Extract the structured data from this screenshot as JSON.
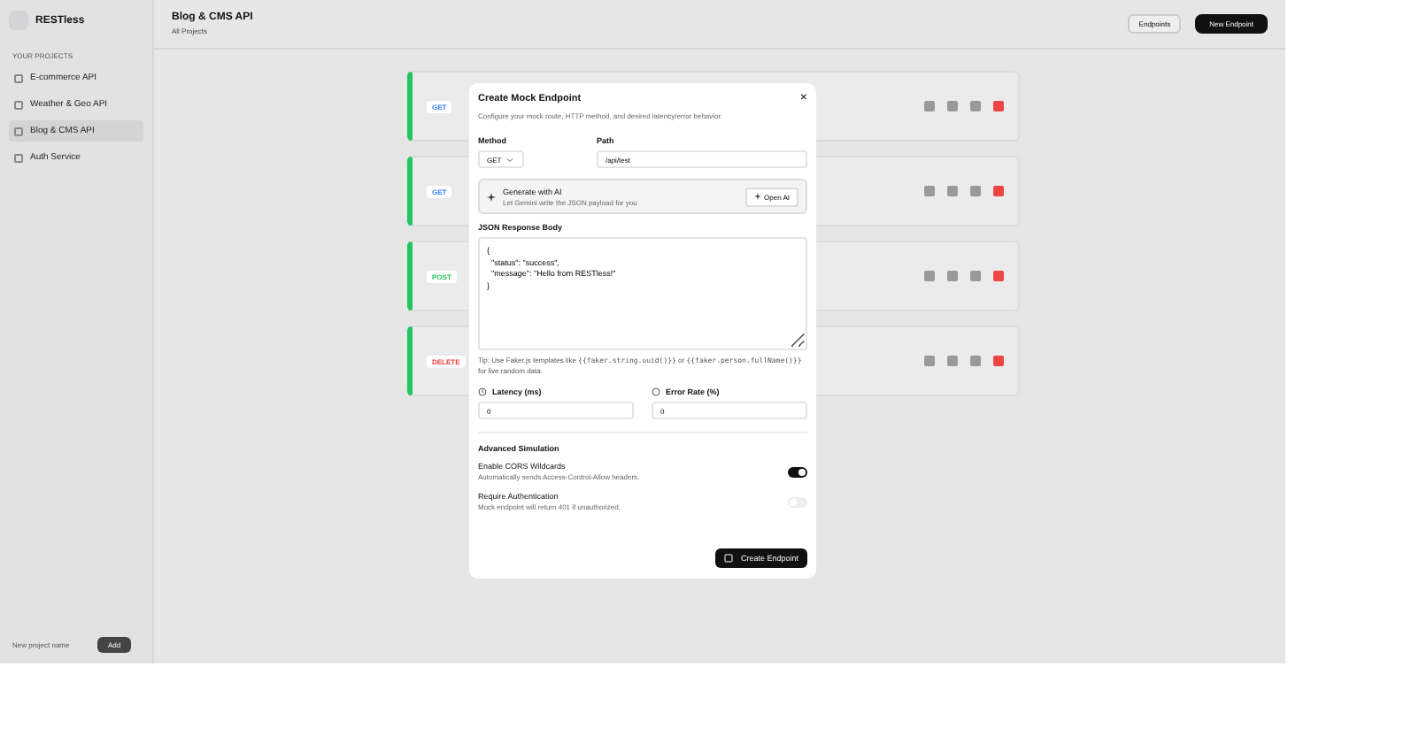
{
  "sidebar": {
    "brand": "RESTless",
    "section_label": "YOUR PROJECTS",
    "projects": [
      {
        "name": "E-commerce API",
        "selected": false
      },
      {
        "name": "Weather & Geo API",
        "selected": false
      },
      {
        "name": "Blog & CMS API",
        "selected": true
      },
      {
        "name": "Auth Service",
        "selected": false
      }
    ],
    "new_project": {
      "placeholder": "New project name",
      "button": "Add"
    }
  },
  "header": {
    "title": "Blog & CMS API",
    "breadcrumb": "All Projects",
    "view_select": "Endpoints",
    "primary_button": "New Endpoint"
  },
  "endpoints": [
    {
      "method": "GET",
      "color": "#3b82f6"
    },
    {
      "method": "GET",
      "color": "#3b82f6"
    },
    {
      "method": "POST",
      "color": "#22c55e"
    },
    {
      "method": "DELETE",
      "color": "#ef4444"
    }
  ],
  "dialog": {
    "title": "Create Mock Endpoint",
    "close": "×",
    "subtitle": "Configure your mock route, HTTP method, and desired latency/error behavior.",
    "method_label": "Method",
    "method_value": "GET",
    "path_label": "Path",
    "path_value": "/api/test",
    "ai": {
      "title": "Generate with AI",
      "subtitle": "Let Gemini write the JSON payload for you",
      "button": "Open AI"
    },
    "body_label": "JSON Response Body",
    "body_lines": [
      "{",
      "  \"status\": \"success\",",
      "  \"message\": \"Hello from RESTless!\"",
      "}"
    ],
    "tip": [
      {
        "kind": "plain",
        "text": "Tip: Use Faker.js templates like "
      },
      {
        "kind": "code",
        "text": "{{faker.string.uuid()}}"
      },
      {
        "kind": "plain",
        "text": " or "
      },
      {
        "kind": "code",
        "text": "{{faker.person.fullName()}}"
      },
      {
        "kind": "plain",
        "text": " for live random data."
      }
    ],
    "latency": {
      "label": "Latency (ms)",
      "value": "0"
    },
    "error_rate": {
      "label": "Error Rate (%)",
      "value": "0"
    },
    "advanced_title": "Advanced Simulation",
    "toggles": [
      {
        "label": "Enable CORS Wildcards",
        "description": "Automatically sends Access-Control-Allow headers.",
        "on": true
      },
      {
        "label": "Require Authentication",
        "description": "Mock endpoint will return 401 if unauthorized.",
        "on": false
      }
    ],
    "submit": "Create Endpoint"
  }
}
